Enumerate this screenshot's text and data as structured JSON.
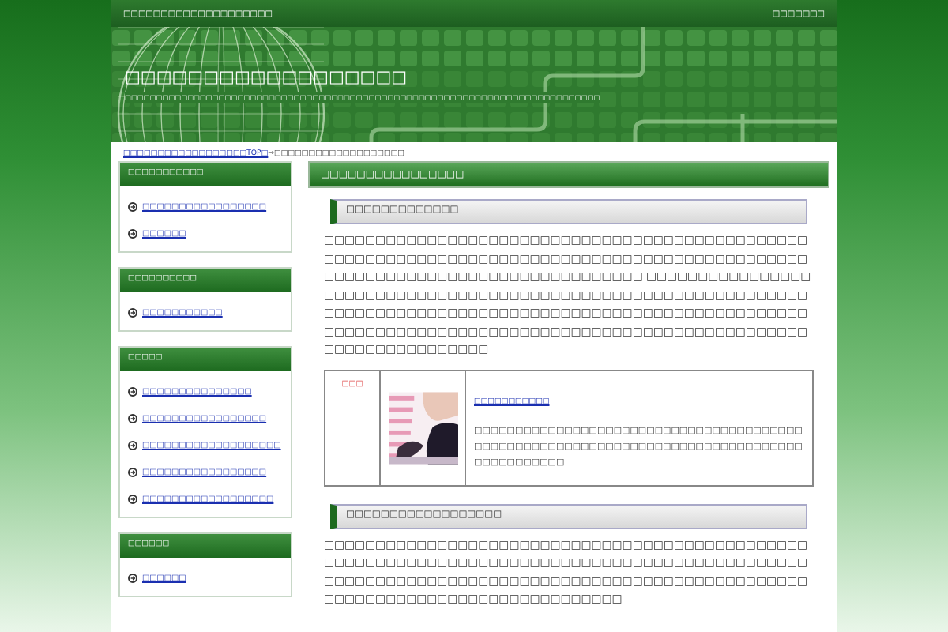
{
  "top_bar": {
    "tagline": "□□□□□□□□□□□□□□□□□□□□",
    "link": "□□□□□□□"
  },
  "header": {
    "title": "□□□□□□□□□□□□□□□□□□",
    "subtitle": "□□□□□□□□□□□□□□□□□□□□□□□□□□□□□□□□□□□□□□□□□□□□□□□□□□□□□□□□□□□□□□□□□□□□□□□□□□□□"
  },
  "breadcrumb": {
    "home": "□□□□□□□□□□□□□□□□□□TOP□",
    "separator": "→",
    "current": "□□□□□□□□□□□□□□□□□□□"
  },
  "sidebar": [
    {
      "title": "□□□□□□□□□□□",
      "items": [
        "□□□□□□□□□□□□□□□□□",
        "□□□□□□"
      ]
    },
    {
      "title": "□□□□□□□□□□",
      "items": [
        "□□□□□□□□□□□"
      ]
    },
    {
      "title": "□□□□□",
      "items": [
        "□□□□□□□□□□□□□□□",
        "□□□□□□□□□□□□□□□□□",
        "□□□□□□□□□□□□□□□□□□□",
        "□□□□□□□□□□□□□□□□□",
        "□□□□□□□□□□□□□□□□□□"
      ]
    },
    {
      "title": "□□□□□□",
      "items": [
        "□□□□□□"
      ]
    }
  ],
  "main": {
    "title": "□□□□□□□□□□□□□□□□",
    "sections": [
      {
        "heading": "□□□□□□□□□□□□□",
        "paragraph": "□□□□□□□□□□□□□□□□□□□□□□□□□□□□□□□□□□□□□□□□□□□□□□□□□□□□□□□□□□□□□□□□□□□□□□□□□□□□□□□□□□□□□□□□□□□□□□□□□□□□□□□□□□□□□□□□□□□□□□□□□□□□□ □□□□□□□□□□□□□□□□□□□□□□□□□□□□□□□□□□□□□□□□□□□□□□□□□□□□□□□□□□□□□□□□□□□□□□□□□□□□□□□□□□□□□□□□□□□□□□□□□□□□□□□□□□□□□□□□□□□□□□□□□□□□□□□□□□□□□□□□□□□□□□□□□□□□□□□□□□□□□□□□□□□□□□□□□□□□□",
        "listing": {
          "rank": "□□□",
          "link": "□□□□□□□□□□□",
          "description": "□□□□□□□□□□□□□□□□□□□□□□□□□□□□□□□□□□□□□□□□□□□□□□□□□□□□□□□□□□□□□□□□□□□□□□□□□□□□□□□□□□□□□□□□□□□"
        }
      },
      {
        "heading": "□□□□□□□□□□□□□□□□□□",
        "paragraph": "□□□□□□□□□□□□□□□□□□□□□□□□□□□□□□□□□□□□□□□□□□□□□□□□□□□□□□□□□□□□□□□□□□□□□□□□□□□□□□□□□□□□□□□□□□□□□□□□□□□□□□□□□□□□□□□□□□□□□□□□□□□□□□□□□□□□□□□□□□□□□□□□□□□□□□□□□□□□□□□□□□□□□□□□□□"
      }
    ]
  }
}
